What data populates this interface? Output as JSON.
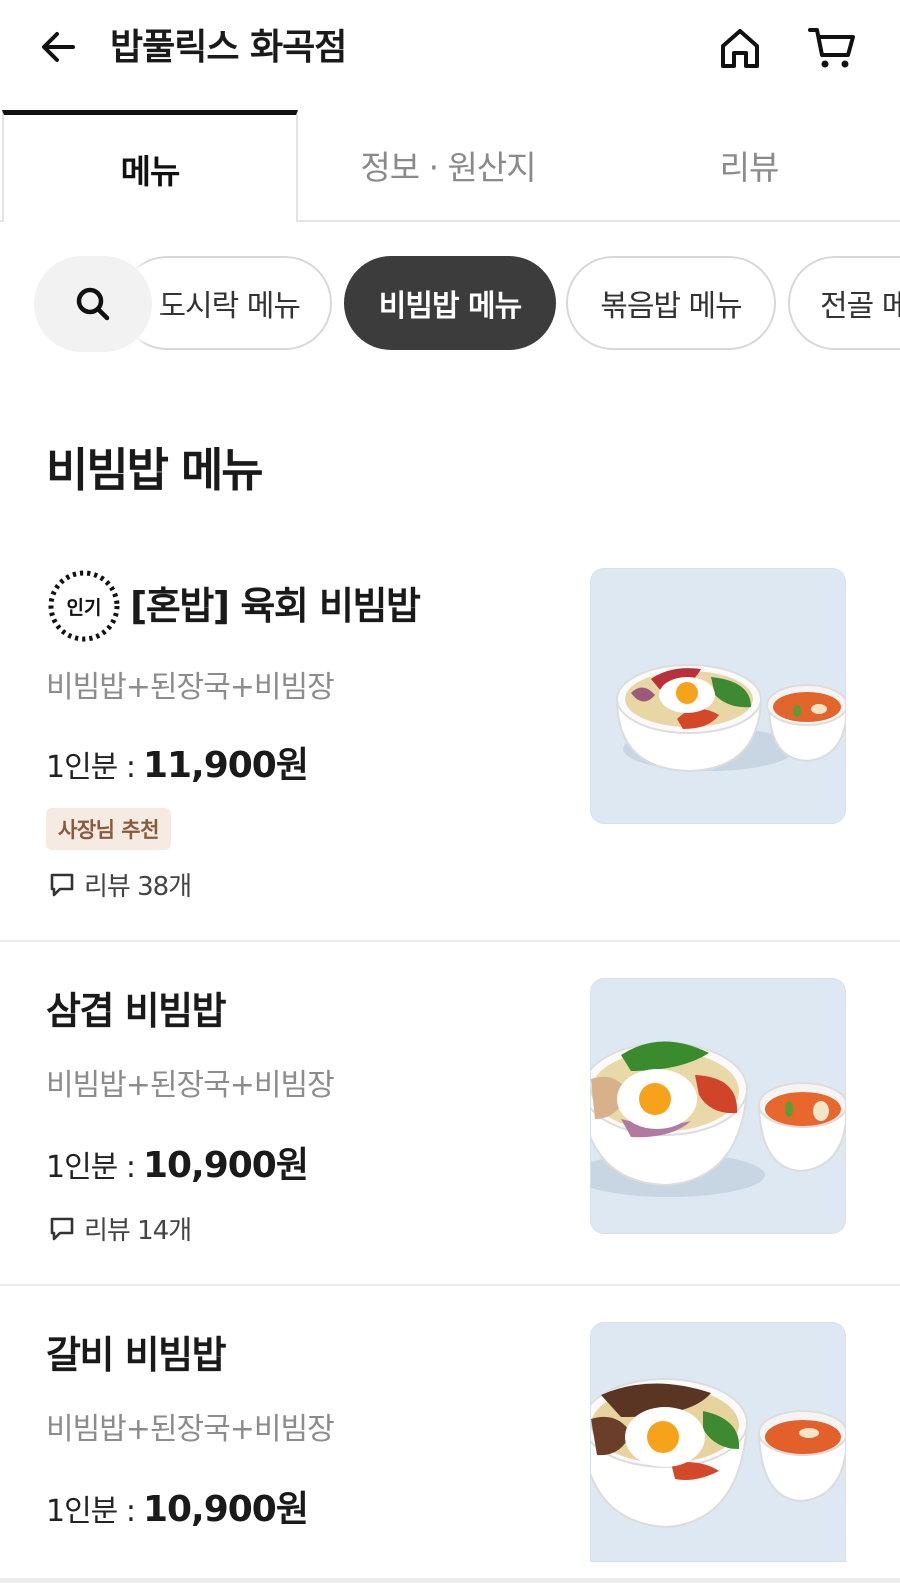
{
  "header": {
    "title": "밥풀릭스 화곡점",
    "back_icon": "arrow-left-icon",
    "home_icon": "home-icon",
    "cart_icon": "cart-icon"
  },
  "tabs": [
    {
      "label": "메뉴",
      "active": true
    },
    {
      "label": "정보 · 원산지",
      "active": false
    },
    {
      "label": "리뷰",
      "active": false
    }
  ],
  "categories": [
    {
      "label": "도시락 메뉴",
      "active": false
    },
    {
      "label": "비빔밥 메뉴",
      "active": true
    },
    {
      "label": "볶음밥 메뉴",
      "active": false
    },
    {
      "label": "전골 메뉴",
      "active": false
    }
  ],
  "section": {
    "title": "비빔밥 메뉴"
  },
  "items": [
    {
      "name": "[혼밥] 육회 비빔밥",
      "popular_badge": "인기",
      "description": "비빔밥+된장국+비빔장",
      "price_prefix": "1인분 :",
      "price": "11,900원",
      "recommend_badge": "사장님 추천",
      "reviews": "리뷰 38개"
    },
    {
      "name": "삼겹 비빔밥",
      "description": "비빔밥+된장국+비빔장",
      "price_prefix": "1인분 :",
      "price": "10,900원",
      "reviews": "리뷰 14개"
    },
    {
      "name": "갈비 비빔밥",
      "description": "비빔밥+된장국+비빔장",
      "price_prefix": "1인분 :",
      "price": "10,900원"
    }
  ],
  "colors": {
    "active_chip": "#3c3c3c",
    "recommend_bg": "#f5ebe3",
    "recommend_text": "#8b5a3c",
    "image_bg": "#dfe9f4"
  }
}
